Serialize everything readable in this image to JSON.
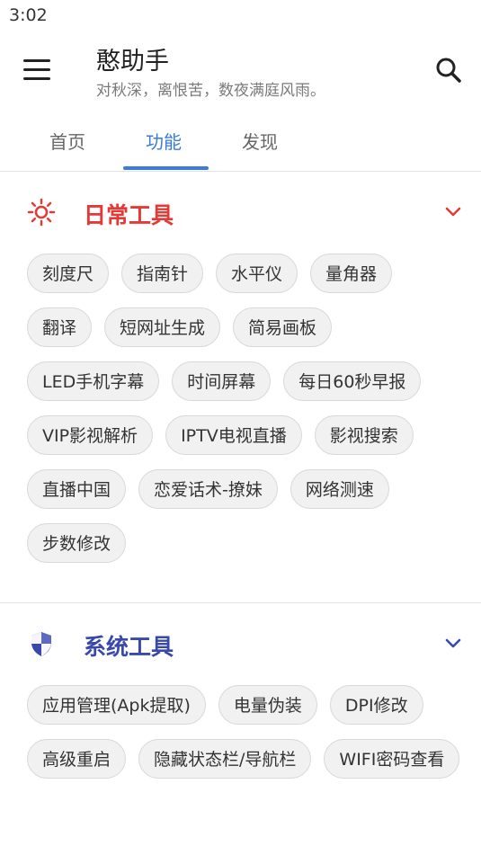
{
  "status": {
    "time": "3:02"
  },
  "header": {
    "title": "憨助手",
    "subtitle": "对秋深，离恨苦，数夜满庭风雨。",
    "menu_icon": "menu-icon",
    "search_icon": "search-icon"
  },
  "tabs": [
    {
      "label": "首页",
      "active": false
    },
    {
      "label": "功能",
      "active": true
    },
    {
      "label": "发现",
      "active": false
    }
  ],
  "colors": {
    "accent": "#3a7be0",
    "daily": "#e53935",
    "system": "#3949ab"
  },
  "sections": {
    "daily": {
      "title": "日常工具",
      "icon": "sun-icon",
      "items": [
        "刻度尺",
        "指南针",
        "水平仪",
        "量角器",
        "翻译",
        "短网址生成",
        "简易画板",
        "LED手机字幕",
        "时间屏幕",
        "每日60秒早报",
        "VIP影视解析",
        "IPTV电视直播",
        "影视搜索",
        "直播中国",
        "恋爱话术-撩妹",
        "网络测速",
        "步数修改"
      ]
    },
    "system": {
      "title": "系统工具",
      "icon": "shield-icon",
      "items": [
        "应用管理(Apk提取)",
        "电量伪装",
        "DPI修改",
        "高级重启",
        "隐藏状态栏/导航栏",
        "WIFI密码查看"
      ]
    }
  }
}
